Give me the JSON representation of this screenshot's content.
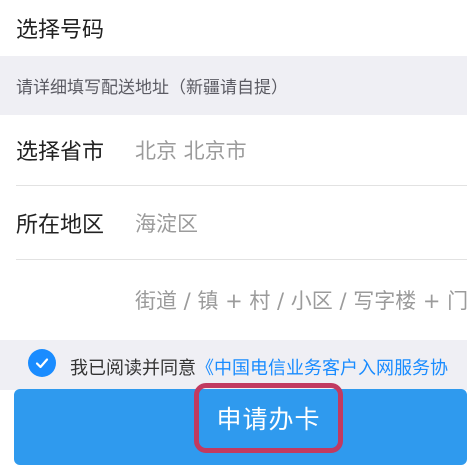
{
  "top": {
    "label": "选择号码"
  },
  "notice": {
    "text": "请详细填写配送地址（新疆请自提）"
  },
  "form": {
    "province": {
      "label": "选择省市",
      "value": "北京  北京市"
    },
    "district": {
      "label": "所在地区",
      "value": "海淀区"
    },
    "address": {
      "placeholder": "街道 / 镇 + 村 / 小区 / 写字楼 + 门"
    }
  },
  "agreement": {
    "checked": true,
    "prefix": "我已阅读并同意",
    "link": "《中国电信业务客户入网服务协"
  },
  "apply_button": {
    "label": "申请办卡"
  },
  "colors": {
    "accent": "#2f9aee",
    "link": "#1a8cff",
    "highlight_border": "#c13a60",
    "section_bg": "#efeff4"
  }
}
